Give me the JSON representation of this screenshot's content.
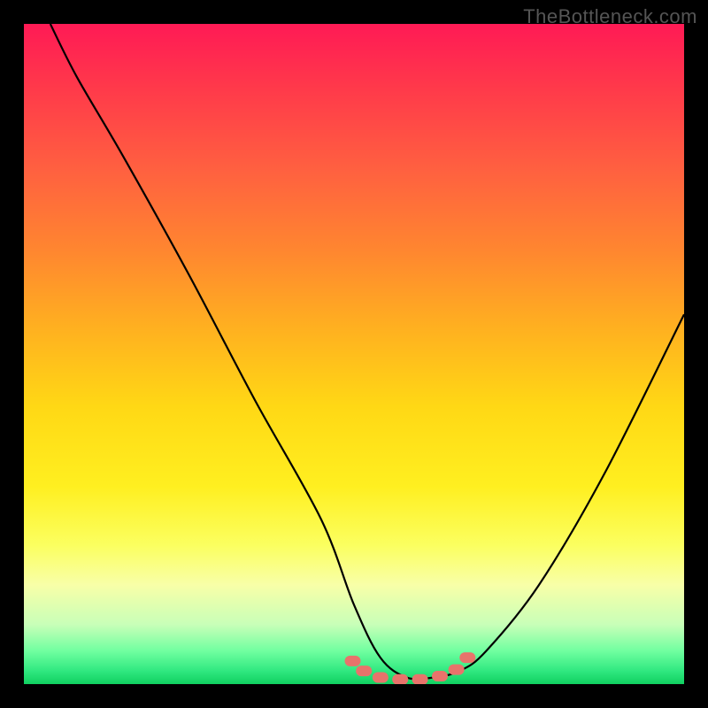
{
  "watermark": "TheBottleneck.com",
  "chart_data": {
    "type": "line",
    "title": "",
    "xlabel": "",
    "ylabel": "",
    "xlim": [
      0,
      100
    ],
    "ylim": [
      0,
      100
    ],
    "series": [
      {
        "name": "bottleneck-curve",
        "x": [
          4,
          8,
          15,
          25,
          35,
          45,
          50,
          54,
          58,
          62,
          66,
          70,
          78,
          88,
          100
        ],
        "y": [
          100,
          92,
          80,
          62,
          43,
          25,
          12,
          4,
          1,
          1,
          2,
          5,
          15,
          32,
          56
        ]
      }
    ],
    "markers": {
      "name": "flat-region-dots",
      "x": [
        49.8,
        51.5,
        54,
        57,
        60,
        63,
        65.5,
        67.2
      ],
      "y": [
        3.5,
        2,
        1,
        0.7,
        0.7,
        1.2,
        2.2,
        4
      ]
    },
    "colors": {
      "curve": "#000000",
      "markers": "#e8736b",
      "gradient_top": "#ff1a55",
      "gradient_bottom": "#10d060"
    }
  }
}
